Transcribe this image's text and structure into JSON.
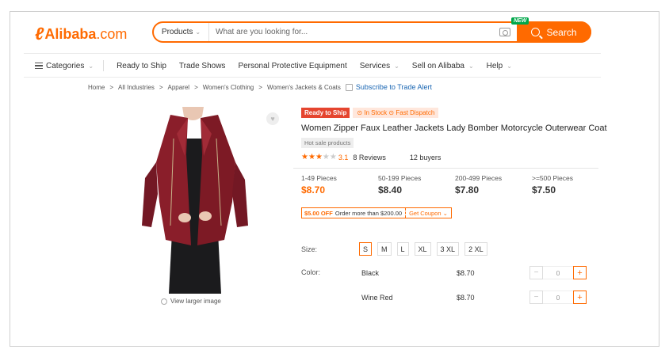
{
  "header": {
    "logo_text": "Alibaba",
    "logo_domain": ".com",
    "search_category": "Products",
    "search_placeholder": "What are you looking for...",
    "search_button": "Search",
    "new_badge": "NEW",
    "brand_color": "#ff6a00"
  },
  "nav": {
    "categories": "Categories",
    "items": [
      "Ready to Ship",
      "Trade Shows",
      "Personal Protective Equipment",
      "Services",
      "Sell on Alibaba",
      "Help"
    ]
  },
  "breadcrumb": {
    "items": [
      "Home",
      "All Industries",
      "Apparel",
      "Women's Clothing",
      "Women's Jackets & Coats"
    ],
    "subscribe": "Subscribe to Trade Alert"
  },
  "product": {
    "view_larger": "View larger image",
    "badge_ready": "Ready to Ship",
    "badge_stock": "In Stock",
    "badge_dispatch": "Fast Dispatch",
    "title": "Women Zipper Faux Leather Jackets Lady Bomber Motorcycle Outerwear Coat",
    "hot": "Hot sale products",
    "rating": "3.1",
    "rating_stars": 3,
    "reviews": "8 Reviews",
    "buyers": "12 buyers",
    "tiers": [
      {
        "qty": "1-49 Pieces",
        "price": "$8.70"
      },
      {
        "qty": "50-199 Pieces",
        "price": "$8.40"
      },
      {
        "qty": "200-499 Pieces",
        "price": "$7.80"
      },
      {
        "qty": ">=500 Pieces",
        "price": "$7.50"
      }
    ],
    "coupon": {
      "off": "$5.00 OFF",
      "condition": "Order more than $200.00",
      "get": "Get Coupon"
    },
    "size_label": "Size:",
    "sizes": [
      "S",
      "M",
      "L",
      "XL",
      "3 XL",
      "2 XL"
    ],
    "selected_size": "S",
    "color_label": "Color:",
    "variants": [
      {
        "name": "Black",
        "price": "$8.70",
        "qty": "0"
      },
      {
        "name": "Wine Red",
        "price": "$8.70",
        "qty": "0"
      }
    ]
  }
}
